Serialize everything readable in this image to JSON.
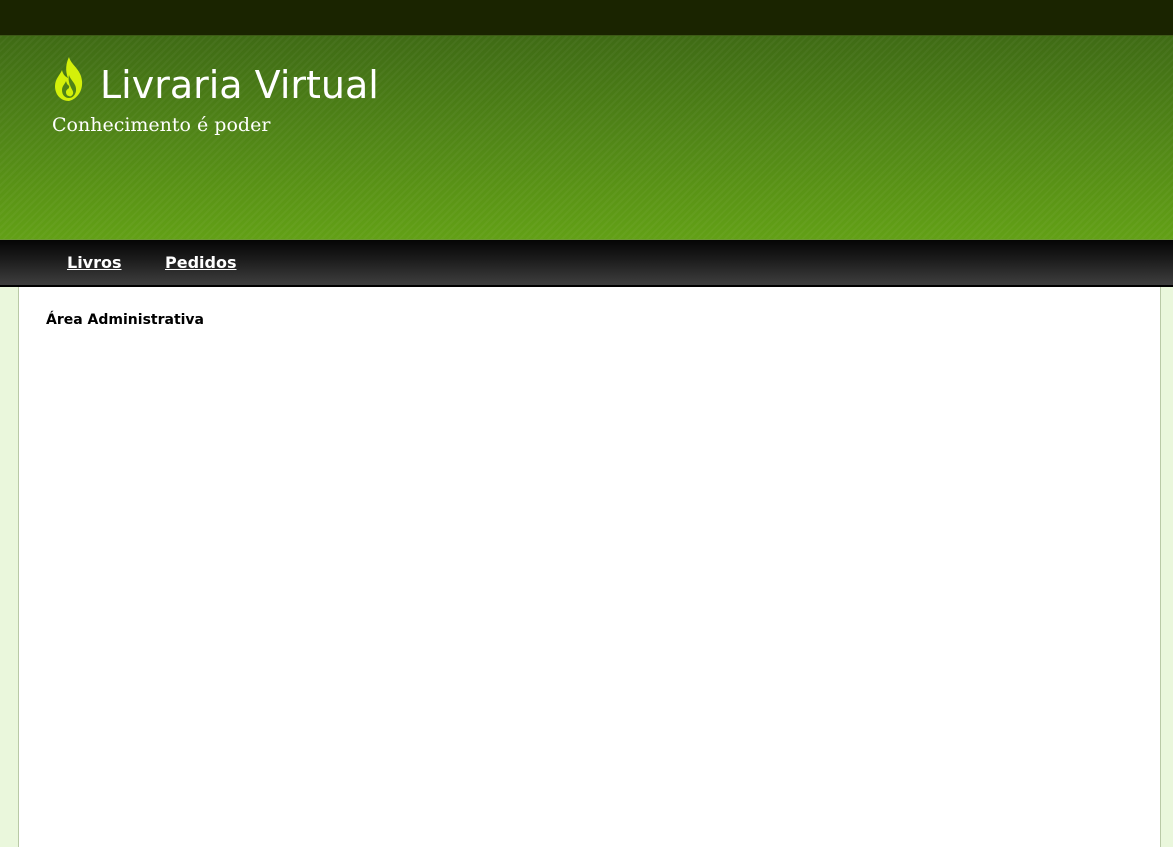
{
  "header": {
    "logo_icon": "flame-icon",
    "title": "Livraria Virtual",
    "slogan": "Conhecimento é poder",
    "colors": {
      "topbar": "#1a2400",
      "header_top": "#3f6b15",
      "header_bottom": "#62a016",
      "logo": "#d4f00a"
    }
  },
  "nav": {
    "items": [
      {
        "label": "Livros"
      },
      {
        "label": "Pedidos"
      }
    ]
  },
  "main": {
    "title": "Área Administrativa"
  }
}
